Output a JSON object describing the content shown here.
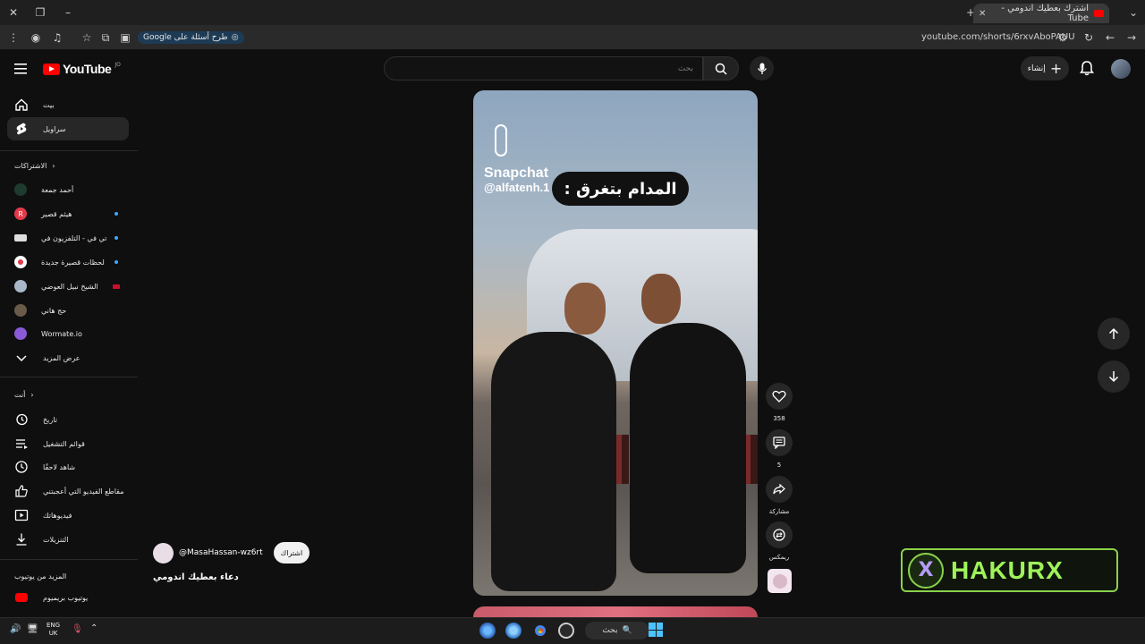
{
  "browser": {
    "tab_title": "اشترك بعطيك اندومي - Tube",
    "url": "youtube.com/shorts/6rxvAboPAUU",
    "google_chip": "طرح أسئلة على Google"
  },
  "header": {
    "logo_text": "YouTube",
    "logo_sup": "JO",
    "search_placeholder": "بحث",
    "create_label": "إنشاء"
  },
  "sidebar": {
    "nav": [
      {
        "label": "بيت",
        "icon": "home-icon"
      },
      {
        "label": "سراويل",
        "icon": "shorts-icon"
      }
    ],
    "subscriptions_title": "الاشتراكات",
    "subscriptions": [
      {
        "label": "أحمد جمعة",
        "color": "#1f3a2e",
        "dot": false
      },
      {
        "label": "هيثم قصير",
        "color": "#e23a4a",
        "dot": true
      },
      {
        "label": "تي في - التلفزيون في",
        "color": "#dddddd",
        "dot": true
      },
      {
        "label": "لحظات قصيرة جديدة",
        "color": "#ffffff",
        "dot": true
      },
      {
        "label": "الشيخ نبيل العوضي",
        "color": "#a8b8c8",
        "dot": false,
        "live": true
      },
      {
        "label": "حج هاني",
        "color": "#6a5a4a",
        "dot": false
      },
      {
        "label": "Wormate.io",
        "color": "#8a5ad8",
        "dot": false
      }
    ],
    "show_more": "عرض المزيد",
    "you_title": "أنت",
    "you_items": [
      {
        "label": "تاريخ",
        "icon": "history-icon"
      },
      {
        "label": "قوائم التشغيل",
        "icon": "playlist-icon"
      },
      {
        "label": "شاهد لاحقًا",
        "icon": "watch-later-icon"
      },
      {
        "label": "مقاطع الفيديو التي أعجبتني",
        "icon": "like-icon"
      },
      {
        "label": "فيديوهاتك",
        "icon": "your-videos-icon"
      },
      {
        "label": "التنزيلات",
        "icon": "download-icon"
      }
    ],
    "more_title": "المزيد من يوتيوب",
    "premium": "يوتيوب بريميوم"
  },
  "video": {
    "snap_logo": "Snapchat",
    "snap_handle": "@alfatenh.1",
    "caption": "المدام بتغرق :",
    "channel_handle": "@MasaHassan-wz6rt",
    "subscribe_label": "اشتراك",
    "title": "دعاء بعطيك اندومي"
  },
  "actions": {
    "likes": "358",
    "comments": "5",
    "share": "مشاركة",
    "remix": "ريمكس"
  },
  "overlay": {
    "badge_text": "HAKURX"
  },
  "taskbar": {
    "lang_top": "ENG",
    "lang_bottom": "UK",
    "search_label": "بحث"
  },
  "colors": {
    "brand_red": "#ff0000",
    "accent_blue": "#3ea6ff",
    "badge_green": "#9ff35a"
  }
}
